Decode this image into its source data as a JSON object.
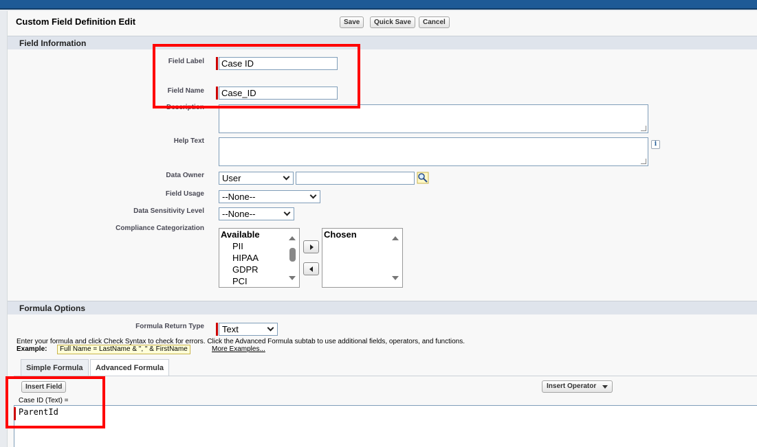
{
  "page": {
    "title": "Custom Field Definition Edit"
  },
  "toolbar": {
    "save_label": "Save",
    "quick_save_label": "Quick Save",
    "cancel_label": "Cancel"
  },
  "field_information": {
    "section_title": "Field Information",
    "field_label": {
      "label": "Field Label",
      "value": "Case ID"
    },
    "field_name": {
      "label": "Field Name",
      "value": "Case_ID"
    },
    "description": {
      "label": "Description",
      "value": ""
    },
    "help_text": {
      "label": "Help Text",
      "value": "",
      "info_icon": "i"
    },
    "data_owner": {
      "label": "Data Owner",
      "selected": "User",
      "lookup_value": ""
    },
    "field_usage": {
      "label": "Field Usage",
      "selected": "--None--"
    },
    "data_sensitivity": {
      "label": "Data Sensitivity Level",
      "selected": "--None--"
    },
    "compliance": {
      "label": "Compliance Categorization",
      "available_header": "Available",
      "available_options": [
        "PII",
        "HIPAA",
        "GDPR",
        "PCI"
      ],
      "chosen_header": "Chosen"
    }
  },
  "formula_options": {
    "section_title": "Formula Options",
    "return_type": {
      "label": "Formula Return Type",
      "selected": "Text"
    },
    "instructions": "Enter your formula and click Check Syntax to check for errors. Click the Advanced Formula subtab to use additional fields, operators, and functions.",
    "example_label": "Example:",
    "example_value": "Full Name = LastName & \", \" & FirstName",
    "more_examples": "More Examples...",
    "tabs": [
      {
        "label": "Simple Formula",
        "active": false
      },
      {
        "label": "Advanced Formula",
        "active": true
      }
    ],
    "insert_field_label": "Insert Field",
    "insert_operator_label": "Insert Operator",
    "formula_header": "Case ID (Text) =",
    "formula_value": "ParentId"
  },
  "colors": {
    "required_marker": "#cc0000",
    "annotation_box": "#ff0000",
    "section_header_bg": "#dfe4ec",
    "banner": "#1e5a96"
  },
  "icons": {
    "lookup": "magnifier-lookup-icon",
    "info": "info-icon",
    "dropdown": "chevron-down-icon"
  }
}
